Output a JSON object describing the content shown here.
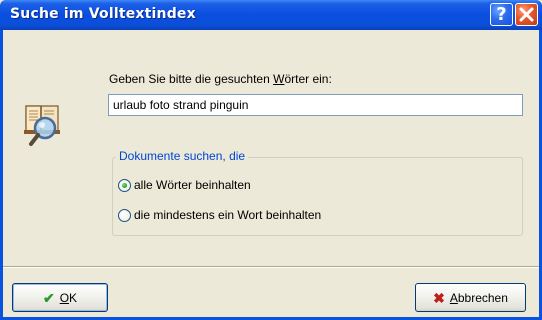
{
  "window": {
    "title": "Suche im Volltextindex",
    "help_glyph": "?",
    "close_icon": "close-icon"
  },
  "prompt": {
    "before": "Geben Sie bitte die gesuchten ",
    "underlined": "W",
    "after": "örter ein:"
  },
  "search": {
    "value": "urlaub foto strand pinguin"
  },
  "group": {
    "legend": "Dokumente suchen, die",
    "options": [
      {
        "label": "alle Wörter beinhalten",
        "checked": true
      },
      {
        "label": "die mindestens ein Wort beinhalten",
        "checked": false
      }
    ]
  },
  "buttons": {
    "ok": {
      "underlined": "O",
      "rest": "K",
      "icon": "checkmark-icon"
    },
    "cancel": {
      "underlined": "A",
      "rest": "bbrechen",
      "icon": "x-icon"
    }
  },
  "colors": {
    "titlebar": "#0a4ee0",
    "legend": "#0046d5",
    "radio_checked": "#21a121",
    "ok_icon": "#2b9a2b",
    "cancel_icon": "#c0201a"
  }
}
